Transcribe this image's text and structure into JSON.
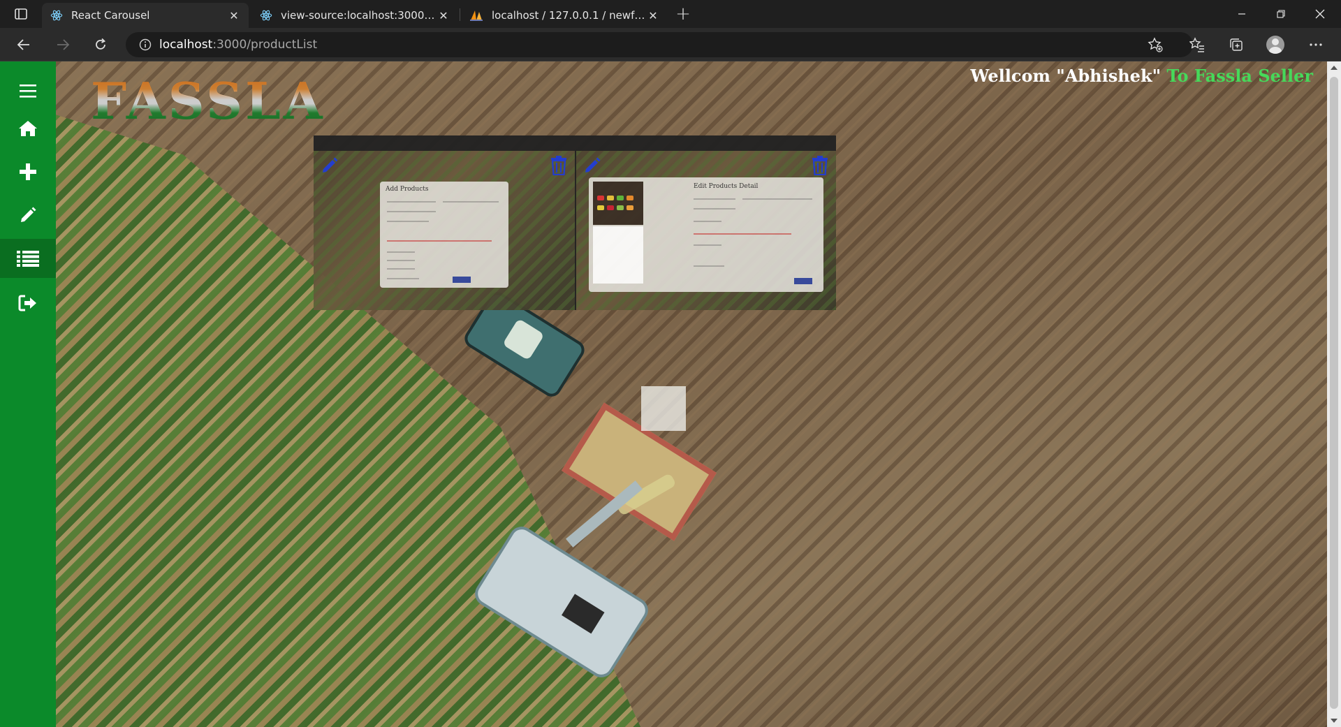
{
  "browser": {
    "tabs": [
      {
        "title": "React Carousel",
        "active": true
      },
      {
        "title": "view-source:localhost:3000/edit_",
        "active": false
      },
      {
        "title": "localhost / 127.0.0.1 / newfassla",
        "active": false
      }
    ],
    "url": {
      "host": "localhost",
      "path": ":3000/productList"
    }
  },
  "sidebar": {
    "items": [
      {
        "name": "menu",
        "icon": "hamburger-icon"
      },
      {
        "name": "home",
        "icon": "home-icon"
      },
      {
        "name": "add",
        "icon": "plus-icon"
      },
      {
        "name": "edit",
        "icon": "pencil-icon"
      },
      {
        "name": "product-list",
        "icon": "list-icon",
        "active": true
      },
      {
        "name": "logout",
        "icon": "sign-out-icon"
      }
    ],
    "color": "#0b8a2a"
  },
  "header": {
    "logo": "FASSLA",
    "welcome_prefix": "Wellcom",
    "user_name": "\"Abhishek\"",
    "welcome_suffix": "To Fassla Seller"
  },
  "products": [
    {
      "image_caption": "Add Products",
      "edit_icon": "pencil-icon",
      "delete_icon": "trash-icon"
    },
    {
      "image_caption": "Edit Products Detail",
      "edit_icon": "pencil-icon",
      "delete_icon": "trash-icon"
    }
  ],
  "colors": {
    "accent_green": "#46d95a",
    "icon_blue": "#1f3bd6"
  }
}
